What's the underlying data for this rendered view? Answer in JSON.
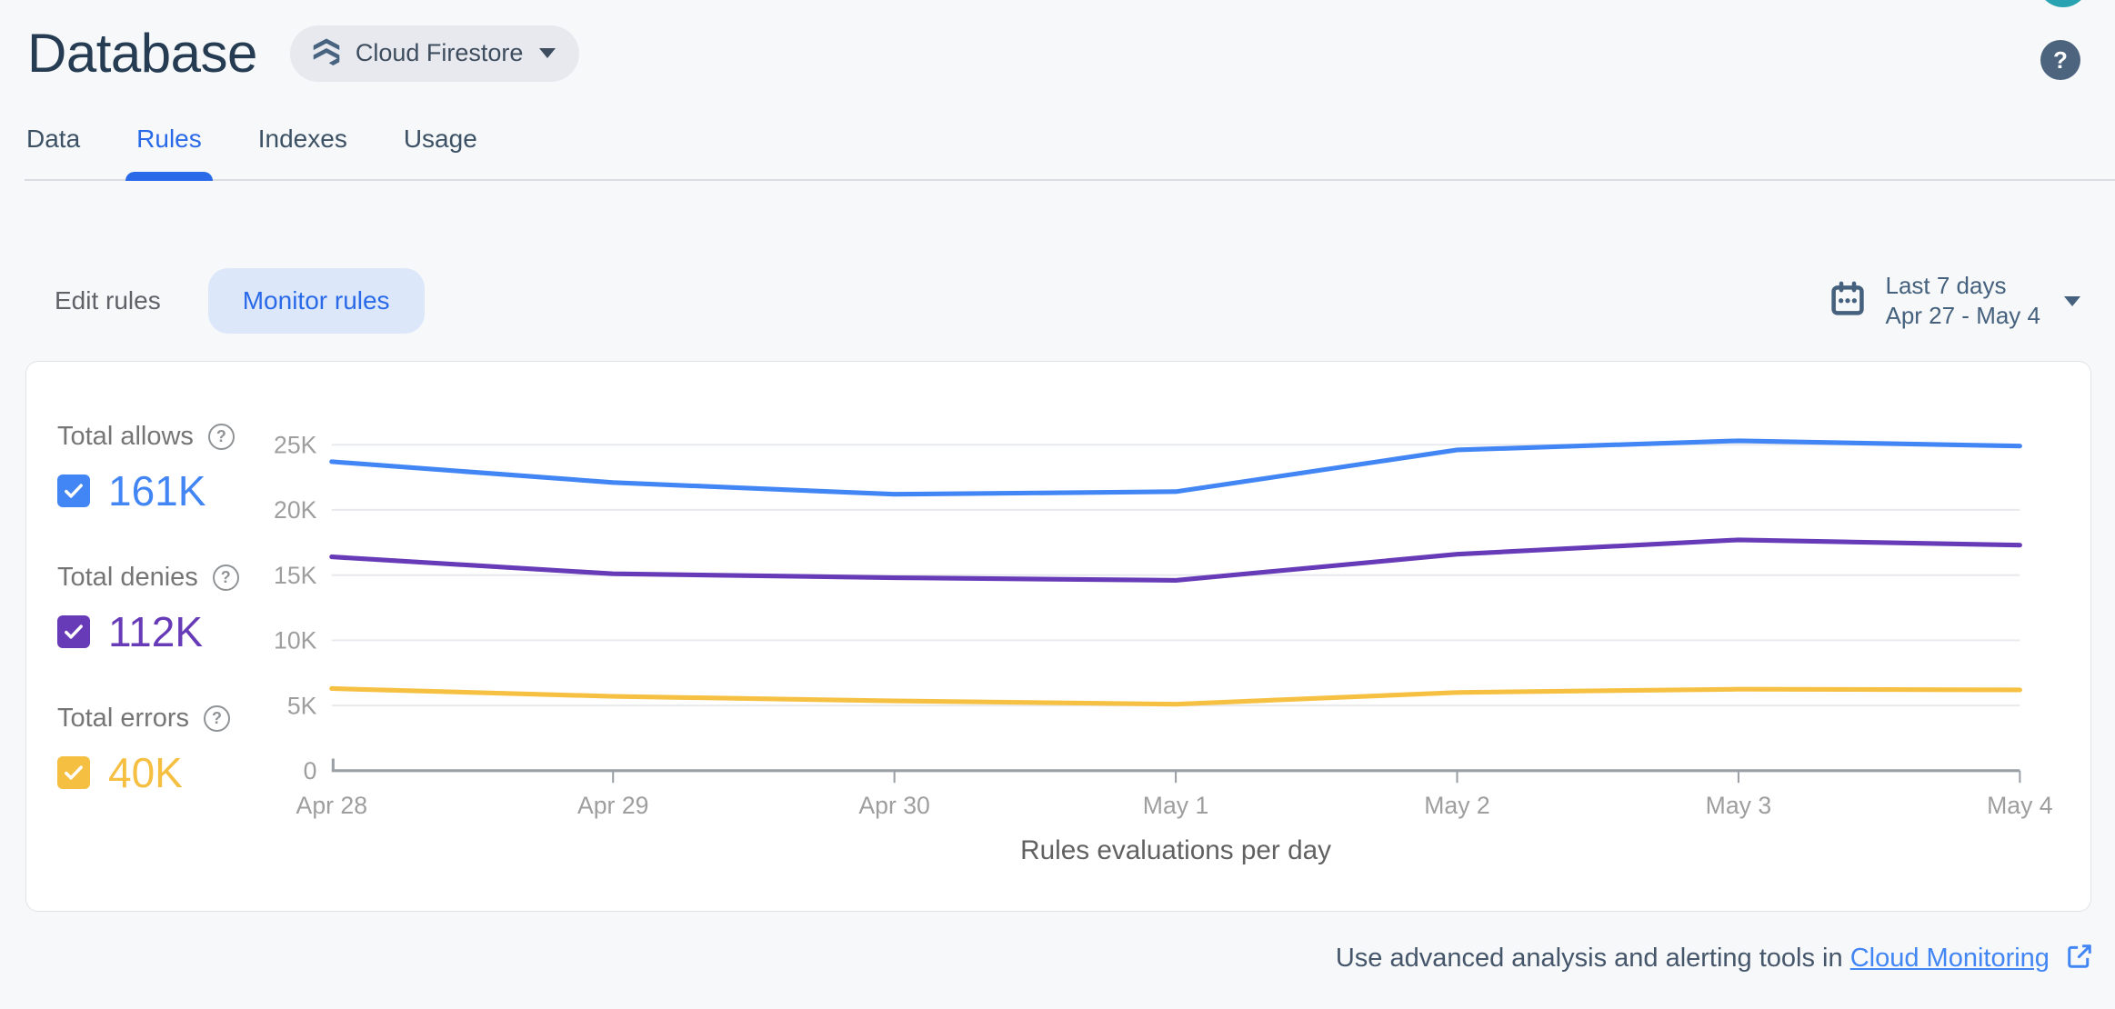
{
  "header": {
    "title": "Database",
    "product_chip": {
      "label": "Cloud Firestore",
      "icon": "firestore-icon"
    },
    "help_glyph": "?"
  },
  "tabs": [
    {
      "label": "Data",
      "active": false
    },
    {
      "label": "Rules",
      "active": true
    },
    {
      "label": "Indexes",
      "active": false
    },
    {
      "label": "Usage",
      "active": false
    }
  ],
  "controls": {
    "edit_rules_label": "Edit rules",
    "monitor_rules_label": "Monitor rules",
    "date_range": {
      "preset": "Last 7 days",
      "range": "Apr 27 - May 4"
    }
  },
  "legend": [
    {
      "label": "Total allows",
      "value": "161K",
      "color": "#4285f4",
      "checked": true
    },
    {
      "label": "Total denies",
      "value": "112K",
      "color": "#673ab7",
      "checked": true
    },
    {
      "label": "Total errors",
      "value": "40K",
      "color": "#f5bf42",
      "checked": true
    }
  ],
  "chart_data": {
    "type": "line",
    "title": "Rules evaluations per day",
    "categories": [
      "Apr 28",
      "Apr 29",
      "Apr 30",
      "May 1",
      "May 2",
      "May 3",
      "May 4"
    ],
    "series": [
      {
        "name": "Total allows",
        "color": "#4285f4",
        "values": [
          23700,
          22100,
          21200,
          21400,
          24600,
          25300,
          24900
        ]
      },
      {
        "name": "Total denies",
        "color": "#673ab7",
        "values": [
          16400,
          15100,
          14800,
          14600,
          16600,
          17700,
          17300
        ]
      },
      {
        "name": "Total errors",
        "color": "#f6c142",
        "values": [
          6300,
          5700,
          5350,
          5100,
          6000,
          6250,
          6200
        ]
      }
    ],
    "ylim": [
      0,
      25000
    ],
    "yticks": [
      "0",
      "5K",
      "10K",
      "15K",
      "20K",
      "25K"
    ],
    "grid": true,
    "legend_position": "left"
  },
  "footer": {
    "text": "Use advanced analysis and alerting tools in",
    "link_label": "Cloud Monitoring"
  },
  "colors": {
    "accent_blue": "#2a6ae8",
    "allows_blue": "#4285f4",
    "denies_purple": "#673ab7",
    "errors_yellow": "#f5bf42",
    "axis_gray": "#9e9e9e",
    "grid_gray": "#e8eaed"
  }
}
